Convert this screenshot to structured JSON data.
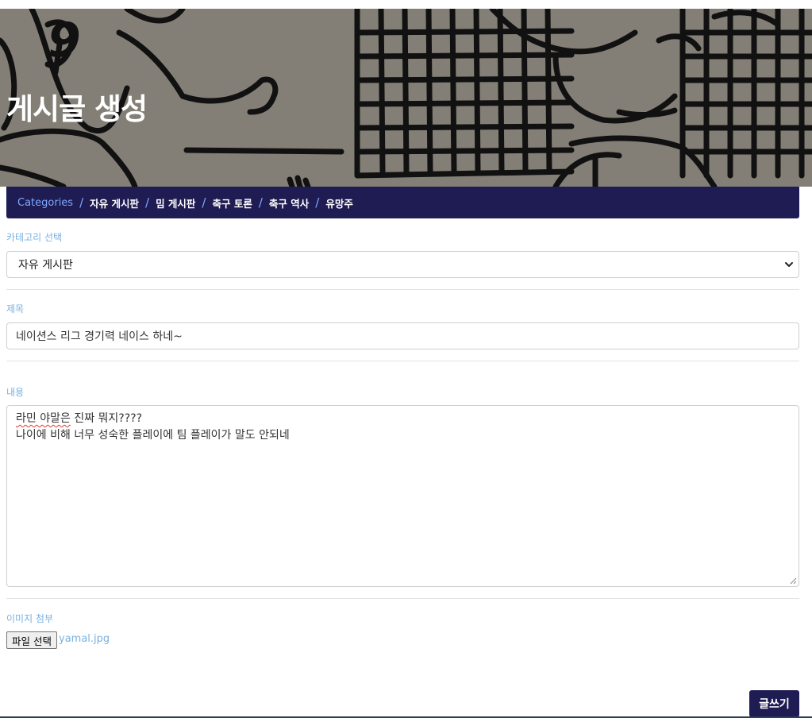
{
  "page": {
    "title": "게시글 생성"
  },
  "breadcrumb": {
    "root": "Categories",
    "separator": "/",
    "items": [
      "자유 게시판",
      "밈 게시판",
      "축구 토론",
      "축구 역사",
      "유망주"
    ]
  },
  "form": {
    "category": {
      "label": "카테고리 선택",
      "selected": "자유 게시판"
    },
    "title": {
      "label": "제목",
      "value": "네이션스 리그 경기력 네이스 하네~"
    },
    "content": {
      "label": "내용",
      "line1_prefix": "라민 야말은",
      "line1_rest": " 진짜 뭐지????",
      "line2": "나이에 비해 너무 성숙한 플레이에 팀 플레이가 말도 안되네"
    },
    "image": {
      "label": "이미지 첨부",
      "button": "파일 선택",
      "file_name": "yamal.jpg"
    },
    "submit": "글쓰기"
  },
  "colors": {
    "navy": "#1e1c52",
    "label_blue": "#7ab0e0",
    "hero_bg": "#837f76"
  }
}
